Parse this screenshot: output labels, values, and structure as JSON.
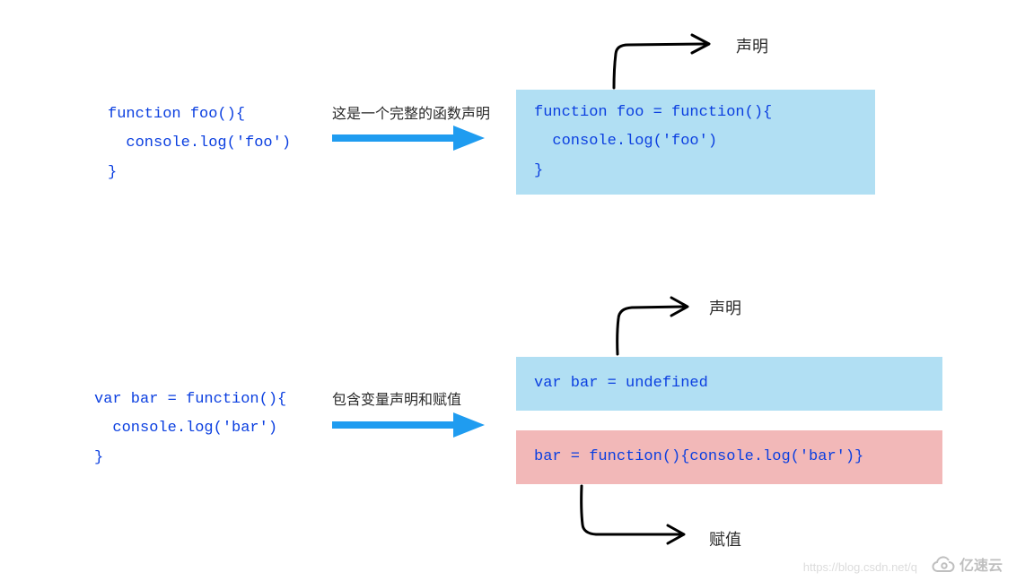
{
  "section1": {
    "source_code": "function foo(){\n  console.log('foo')\n}",
    "caption": "这是一个完整的函数声明",
    "result_code": "function foo = function(){\n  console.log('foo')\n}",
    "top_label": "声明"
  },
  "section2": {
    "source_code": "var bar = function(){\n  console.log('bar')\n}",
    "caption": "包含变量声明和赋值",
    "declaration_code": "var bar = undefined",
    "assignment_code": "bar = function(){console.log('bar')}",
    "top_label": "声明",
    "bottom_label": "赋值"
  },
  "watermark": {
    "url": "https://blog.csdn.net/q",
    "brand": "亿速云"
  },
  "colors": {
    "code_blue": "#0b3fe0",
    "box_blue": "#b1dff3",
    "box_red": "#f2b8b8",
    "arrow_blue": "#1f9cf0"
  }
}
